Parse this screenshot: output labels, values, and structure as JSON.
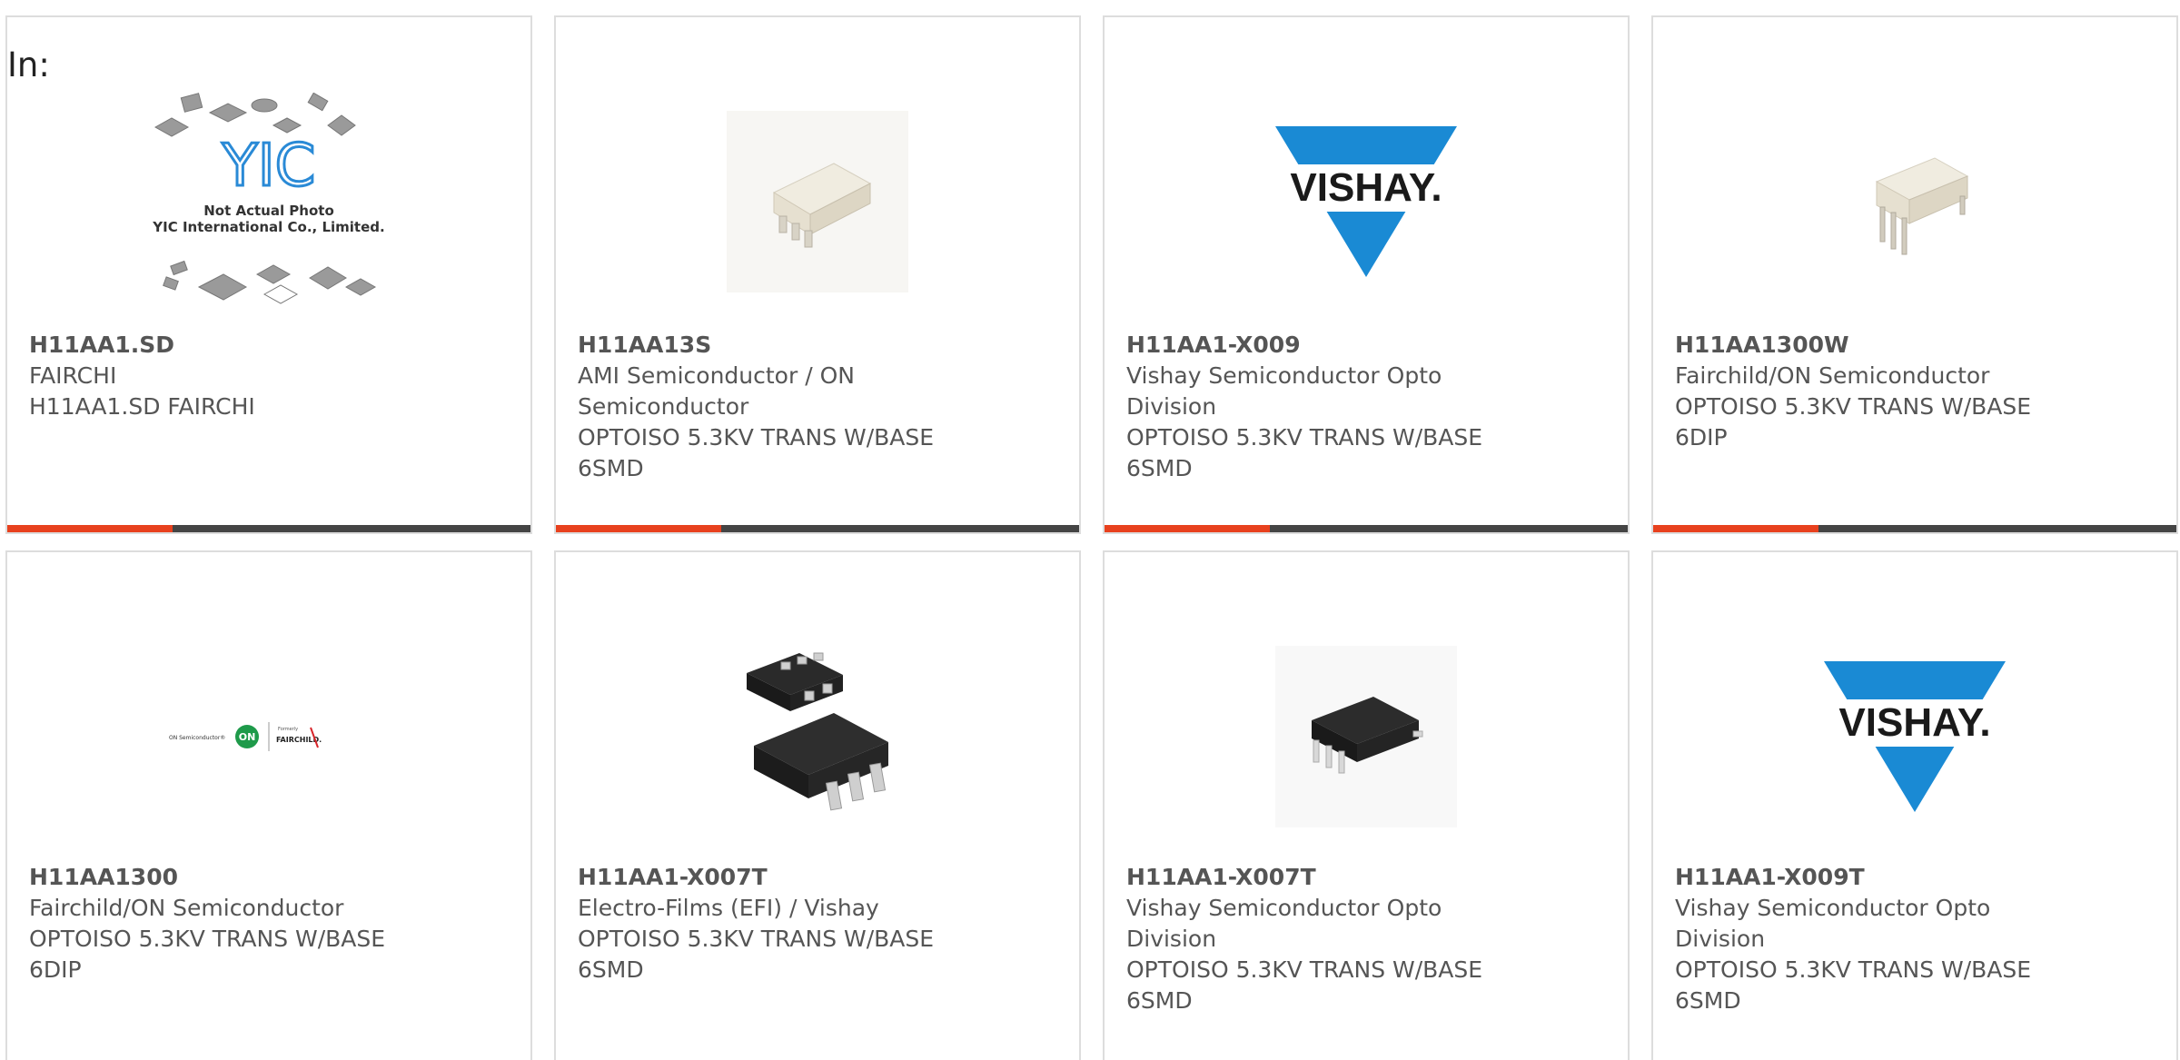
{
  "header": {
    "in_label": "In:"
  },
  "colors": {
    "accent": "#e8411e",
    "bar": "#444444",
    "border": "#dddddd",
    "text": "#555555",
    "vishay_blue": "#1a8ad4"
  },
  "products": [
    {
      "part": "H11AA1.SD",
      "manufacturer": "FAIRCHI",
      "description": "H11AA1.SD FAIRCHI",
      "image": "yic-placeholder-photo",
      "yic_line1": "Not Actual Photo",
      "yic_line2": "YIC International Co., Limited.",
      "yic_logo": "YIC"
    },
    {
      "part": "H11AA13S",
      "manufacturer": "AMI Semiconductor / ON Semiconductor",
      "description": "OPTOISO 5.3KV TRANS W/BASE 6SMD",
      "image": "white-6smd-package"
    },
    {
      "part": "H11AA1-X009",
      "manufacturer": "Vishay Semiconductor Opto Division",
      "description": "OPTOISO 5.3KV TRANS W/BASE 6SMD",
      "image": "vishay-logo",
      "logo_text": "VISHAY."
    },
    {
      "part": "H11AA1300W",
      "manufacturer": "Fairchild/ON Semiconductor",
      "description": "OPTOISO 5.3KV TRANS W/BASE 6DIP",
      "image": "white-6dip-package"
    },
    {
      "part": "H11AA1300",
      "manufacturer": "Fairchild/ON Semiconductor",
      "description": "OPTOISO 5.3KV TRANS W/BASE 6DIP",
      "image": "on-fairchild-logo",
      "logo_left": "ON Semiconductor®",
      "logo_mid": "ON",
      "logo_small": "Formerly",
      "logo_right": "FAIRCHILD."
    },
    {
      "part": "H11AA1-X007T",
      "manufacturer": "Electro-Films (EFI) / Vishay",
      "description": "OPTOISO 5.3KV TRANS W/BASE 6SMD",
      "image": "black-smd-packages"
    },
    {
      "part": "H11AA1-X007T",
      "manufacturer": "Vishay Semiconductor Opto Division",
      "description": "OPTOISO 5.3KV TRANS W/BASE 6SMD",
      "image": "black-6smd-package"
    },
    {
      "part": "H11AA1-X009T",
      "manufacturer": "Vishay Semiconductor Opto Division",
      "description": "OPTOISO 5.3KV TRANS W/BASE 6SMD",
      "image": "vishay-logo",
      "logo_text": "VISHAY."
    }
  ]
}
